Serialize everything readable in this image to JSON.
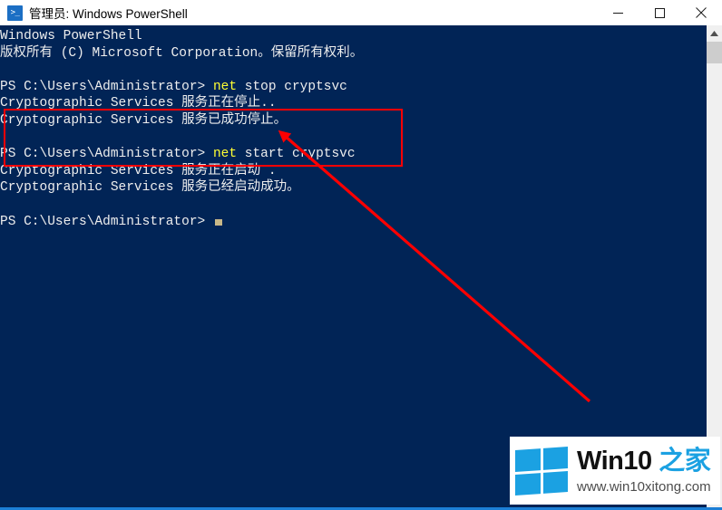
{
  "window": {
    "title": "管理员: Windows PowerShell",
    "icon": "powershell-icon",
    "icon_glyph": ">_",
    "controls": {
      "minimize_label": "最小化",
      "maximize_label": "最大化",
      "close_label": "关闭"
    },
    "titlebar_bg": "#ffffff",
    "console_bg": "#012456",
    "console_fg": "#eeeeee"
  },
  "console": {
    "lines": [
      {
        "text": "Windows PowerShell"
      },
      {
        "text": "版权所有 (C) Microsoft Corporation。保留所有权利。"
      },
      {
        "text": ""
      },
      {
        "prompt": "PS C:\\Users\\Administrator> ",
        "command_kw": "net",
        "command_args": " stop cryptsvc"
      },
      {
        "text": "Cryptographic Services 服务正在停止.."
      },
      {
        "text": "Cryptographic Services 服务已成功停止。"
      },
      {
        "text": ""
      },
      {
        "prompt": "PS C:\\Users\\Administrator> ",
        "command_kw": "net",
        "command_args": " start cryptsvc"
      },
      {
        "text": "Cryptographic Services 服务正在启动 ."
      },
      {
        "text": "Cryptographic Services 服务已经启动成功。"
      },
      {
        "text": ""
      },
      {
        "prompt": "PS C:\\Users\\Administrator> ",
        "cursor": true
      }
    ],
    "keyword_color": "#ffff33",
    "cursor_color": "#c8b888"
  },
  "annotation": {
    "highlight_box_color": "#ff0000",
    "arrow_color": "#ff0000",
    "arrow_from": "650,443",
    "arrow_to": "308,145"
  },
  "watermark": {
    "brand_en": "Win10",
    "brand_cn": "之家",
    "url": "www.win10xitong.com",
    "logo": "windows-logo",
    "logo_color": "#1ba1e2",
    "brand_color": "#111111"
  },
  "scrollbar": {
    "up_arrow": "▲"
  }
}
